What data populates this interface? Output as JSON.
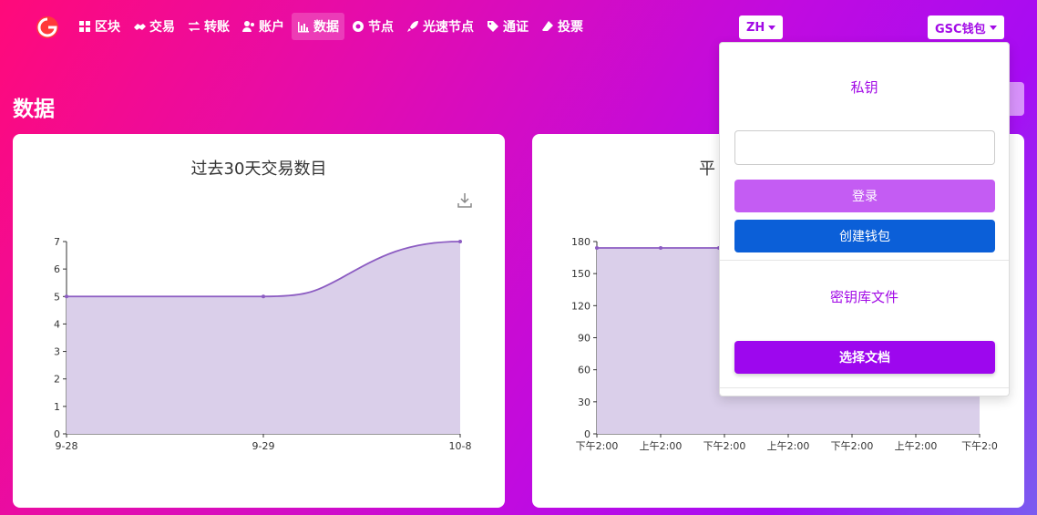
{
  "nav": {
    "items": [
      {
        "label": "区块",
        "icon": "grid-icon"
      },
      {
        "label": "交易",
        "icon": "handshake-icon"
      },
      {
        "label": "转账",
        "icon": "exchange-icon"
      },
      {
        "label": "账户",
        "icon": "users-icon"
      },
      {
        "label": "数据",
        "icon": "bar-chart-icon",
        "active": true
      },
      {
        "label": "节点",
        "icon": "circle-dot-icon"
      },
      {
        "label": "光速节点",
        "icon": "rocket-icon"
      },
      {
        "label": "通证",
        "icon": "tag-icon"
      },
      {
        "label": "投票",
        "icon": "eraser-icon"
      }
    ],
    "lang_label": "ZH",
    "wallet_label": "GSC钱包"
  },
  "page": {
    "title": "数据"
  },
  "left_card": {
    "title": "过去30天交易数目"
  },
  "right_card": {
    "title": "平"
  },
  "wallet_dropdown": {
    "private_key_heading": "私钥",
    "private_key_value": "",
    "login_label": "登录",
    "create_label": "创建钱包",
    "keystore_heading": "密钥库文件",
    "choose_file_label": "选择文档"
  },
  "colors": {
    "accent": "#a20ae6",
    "login_button": "#c45cf3",
    "create_button": "#0b5fd8",
    "choose_button": "#9d07ee",
    "area_fill": "#dacfea",
    "area_line": "#8c5cc2"
  },
  "chart_data": [
    {
      "type": "area",
      "title": "过去30天交易数目",
      "x": [
        "9-28",
        "9-29",
        "10-8"
      ],
      "values": [
        5,
        5,
        7
      ],
      "ylim": [
        0,
        7
      ],
      "yticks": [
        0,
        1,
        2,
        3,
        4,
        5,
        6,
        7
      ],
      "grid": false
    },
    {
      "type": "area",
      "title": "平",
      "x": [
        "下午2:00",
        "上午2:00",
        "下午2:00",
        "上午2:00",
        "下午2:00",
        "上午2:00",
        "下午2:0"
      ],
      "values": [
        174,
        174,
        174
      ],
      "ylim": [
        0,
        180
      ],
      "yticks": [
        0,
        30,
        60,
        90,
        120,
        150,
        180
      ],
      "grid": false
    }
  ]
}
